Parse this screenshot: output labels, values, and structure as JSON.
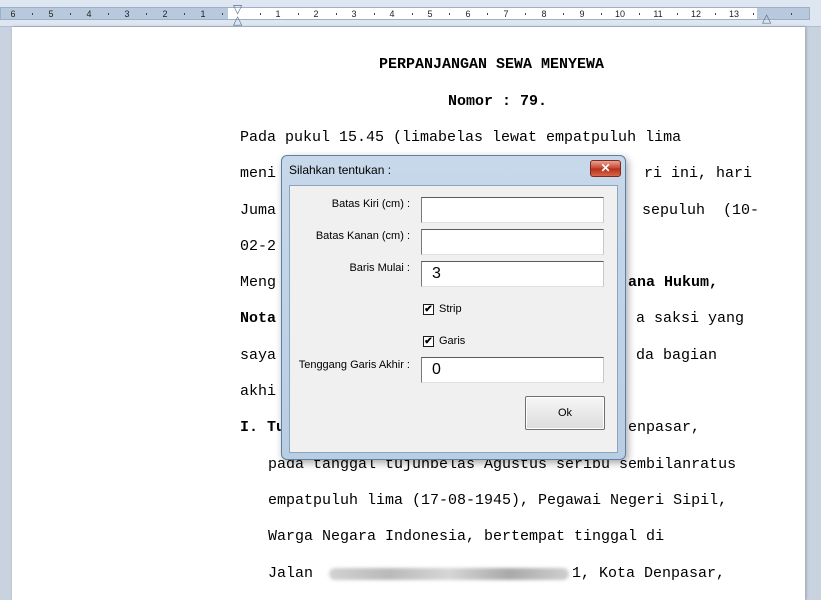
{
  "ruler": {
    "left_numbers": [
      "6",
      "5",
      "4",
      "3",
      "2",
      "1"
    ],
    "right_numbers": [
      "1",
      "2",
      "3",
      "4",
      "5",
      "6",
      "7",
      "8",
      "9",
      "10",
      "11",
      "12",
      "13"
    ]
  },
  "document": {
    "title": "PERPANJANGAN SEWA MENYEWA",
    "number": "Nomor : 79.",
    "lines": [
      "Pada pukul 15.45 (limabelas lewat empatpuluh lima",
      "meni",
      "ri ini, hari",
      "Juma",
      "sepuluh  (10-",
      "02-2",
      "Meng",
      "ana Hukum,",
      "Nota",
      "a saksi yang",
      "saya",
      "da bagian",
      "akhi",
      "I. Tu",
      "enpasar,",
      "pada tanggal tujuhbelas Agustus seribu sembilanratus",
      "empatpuluh lima (17-08-1945), Pegawai Negeri Sipil,",
      "Warga Negara Indonesia, bertempat tinggal di",
      "Jalan",
      "1, Kota Denpasar,"
    ]
  },
  "dialog": {
    "title": "Silahkan tentukan :",
    "close_label": "✕",
    "fields": {
      "batas_kiri": {
        "label": "Batas Kiri (cm) :",
        "value": ""
      },
      "batas_kanan": {
        "label": "Batas Kanan (cm) :",
        "value": ""
      },
      "baris_mulai": {
        "label": "Baris Mulai :",
        "value": "3"
      },
      "tenggang": {
        "label": "Tenggang Garis Akhir :",
        "value": "0"
      }
    },
    "checkboxes": {
      "strip": {
        "label": "Strip",
        "checked": true,
        "mark": "✔"
      },
      "garis": {
        "label": "Garis",
        "checked": true,
        "mark": "✔"
      }
    },
    "ok_label": "Ok"
  }
}
